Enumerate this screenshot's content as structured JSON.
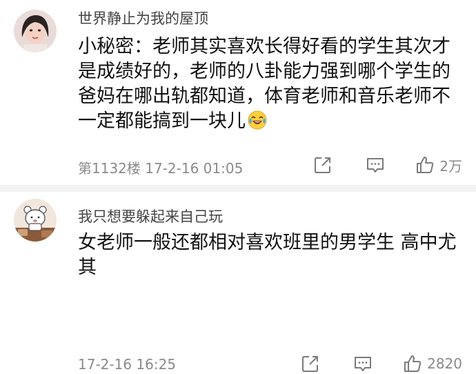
{
  "comments": [
    {
      "username": "世界静止为我的屋顶",
      "text": "小秘密：老师其实喜欢长得好看的学生其次才是成绩好的，老师的八卦能力强到哪个学生的爸妈在哪出轨都知道，体育老师和音乐老师不一定都能搞到一块儿",
      "emoji": "laughing-tears-emoji",
      "meta": "第1132楼 17-2-16 01:05",
      "likes": "2万"
    },
    {
      "username": "我只想要躲起来自己玩",
      "text": "女老师一般还都相对喜欢班里的男学生 高中尤其",
      "meta": "17-2-16 16:25",
      "likes": "2820"
    }
  ],
  "colors": {
    "divider": "#f2f2f2",
    "meta_text": "#8a8a8a",
    "icon_stroke": "#7a7a7a",
    "emoji_face": "#ffcf3d",
    "emoji_tear": "#4aa8f0"
  },
  "icons": [
    "share-icon",
    "reply-icon",
    "like-icon"
  ]
}
